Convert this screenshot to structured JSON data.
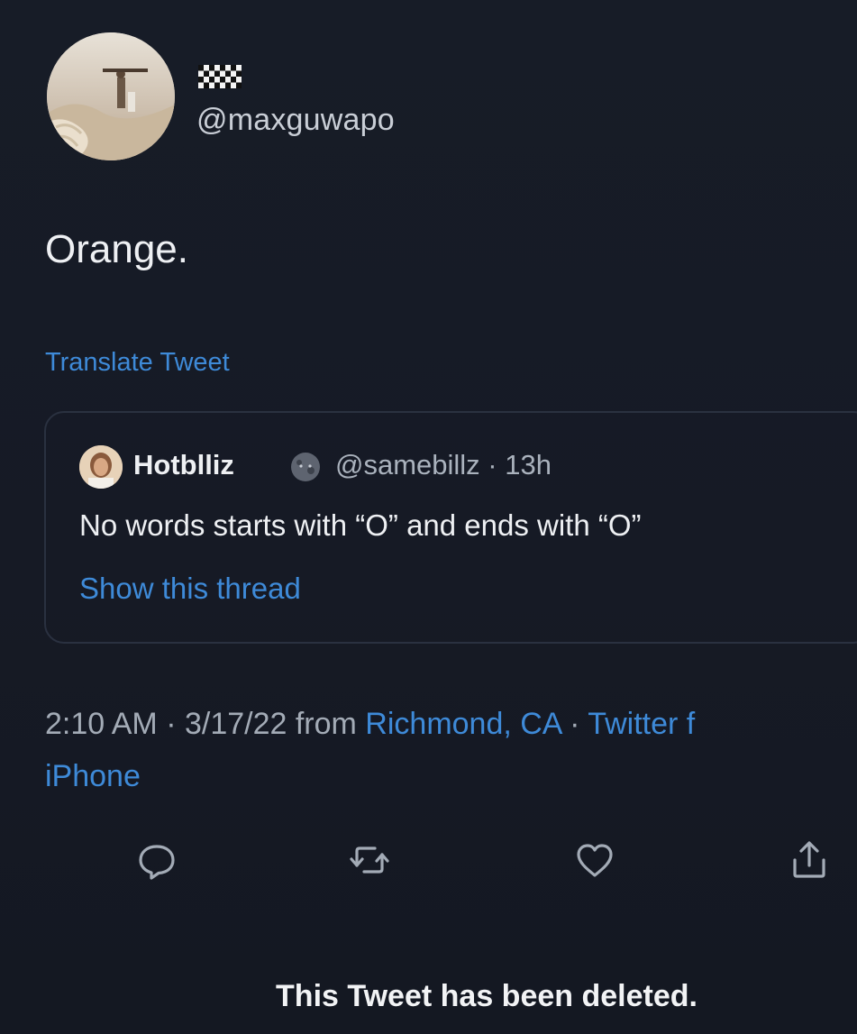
{
  "author": {
    "handle": "@maxguwapo",
    "flag_icon": "checkered-flag-icon"
  },
  "tweet": {
    "text": "Orange.",
    "translate_label": "Translate Tweet"
  },
  "quoted": {
    "name": "Hotblliz",
    "emoji_icon": "moon-face-emoji",
    "handle_time": "@samebillz · 13h",
    "text": "No words starts with “O” and ends with “O”",
    "show_thread": "Show this thread"
  },
  "meta": {
    "time_date": "2:10 AM · 3/17/22 from",
    "location": "Richmond, CA",
    "separator": " · ",
    "source_prefix": "Twitter f",
    "source_line2": "iPhone"
  },
  "actions": {
    "reply_icon": "reply-icon",
    "retweet_icon": "retweet-icon",
    "like_icon": "heart-icon",
    "share_icon": "share-icon"
  },
  "footer": {
    "deleted_text": "This Tweet has been deleted."
  },
  "colors": {
    "background": "#161b26",
    "link": "#3e8ad8",
    "text": "#eef0f3",
    "muted": "#a3abb6"
  }
}
